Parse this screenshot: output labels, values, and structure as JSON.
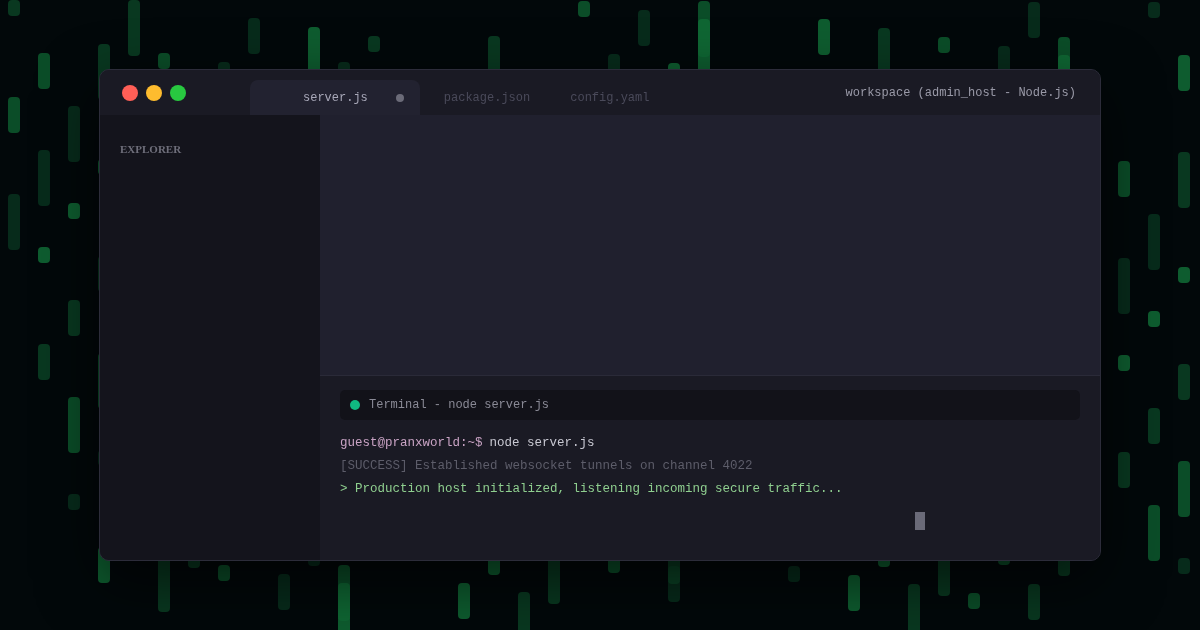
{
  "window": {
    "title": "workspace (admin_host - Node.js)"
  },
  "tabs": [
    {
      "label": "server.js",
      "selected": true,
      "modified": true
    },
    {
      "label": "package.json",
      "selected": false,
      "modified": false
    },
    {
      "label": "config.yaml",
      "selected": false,
      "modified": false
    }
  ],
  "sidebar": {
    "title": "EXPLORER"
  },
  "terminal": {
    "title": "Terminal - node server.js",
    "status": {
      "color": "#10b981"
    },
    "lines": [
      {
        "kind": "prompt",
        "prompt": "guest@pranxworld:~$",
        "command": "node server.js"
      },
      {
        "kind": "muted",
        "text": "[SUCCESS] Established websocket tunnels on channel 4022"
      },
      {
        "kind": "success",
        "text": "> Production host initialized, listening incoming secure traffic..."
      }
    ],
    "cursor": true
  }
}
